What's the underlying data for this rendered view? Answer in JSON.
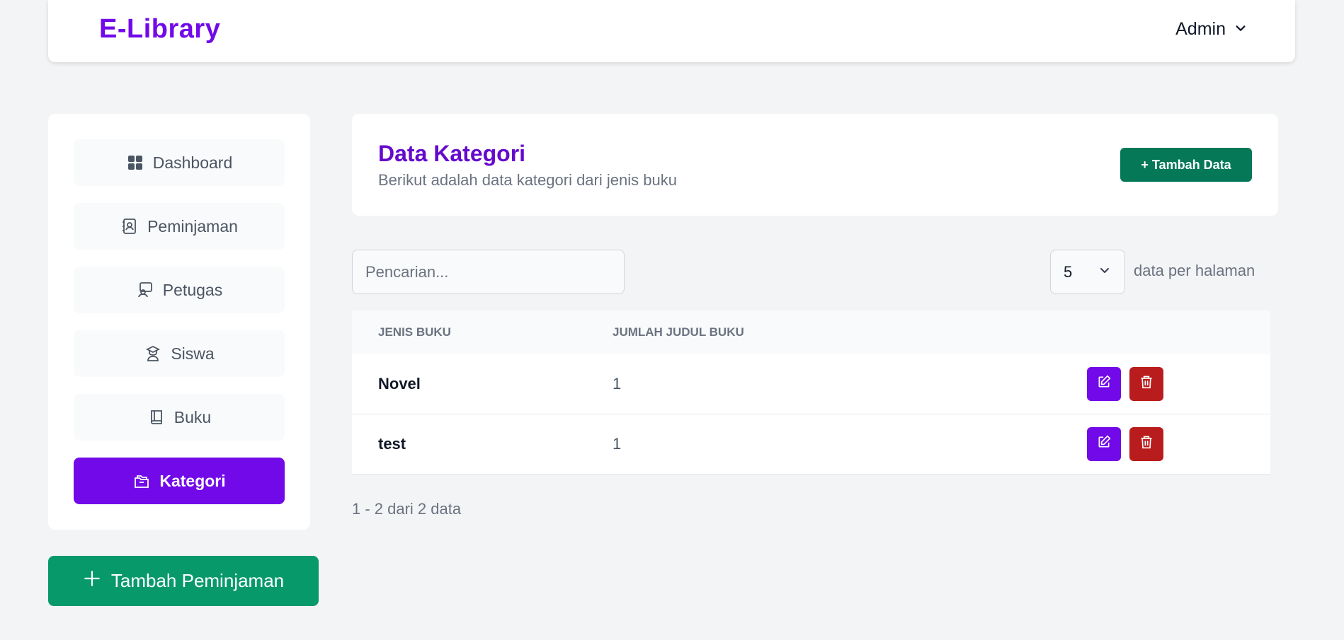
{
  "header": {
    "brand": "E-Library",
    "user_name": "Admin"
  },
  "sidebar": {
    "items": [
      {
        "label": "Dashboard",
        "icon": "dashboard-icon",
        "active": false
      },
      {
        "label": "Peminjaman",
        "icon": "contact-book-icon",
        "active": false
      },
      {
        "label": "Petugas",
        "icon": "staff-icon",
        "active": false
      },
      {
        "label": "Siswa",
        "icon": "student-icon",
        "active": false
      },
      {
        "label": "Buku",
        "icon": "book-icon",
        "active": false
      },
      {
        "label": "Kategori",
        "icon": "folders-icon",
        "active": true
      }
    ],
    "add_loan_label": "Tambah Peminjaman"
  },
  "main": {
    "title": "Data Kategori",
    "subtitle": "Berikut adalah data kategori dari jenis buku",
    "add_button_label": "+ Tambah Data",
    "search": {
      "placeholder": "Pencarian...",
      "value": ""
    },
    "per_page": {
      "value": "5",
      "label": "data per halaman"
    },
    "table": {
      "headers": [
        "Jenis Buku",
        "Jumlah Judul Buku"
      ],
      "rows": [
        {
          "jenis": "Novel",
          "jumlah": "1"
        },
        {
          "jenis": "test",
          "jumlah": "1"
        }
      ]
    },
    "pagination_info": "1 - 2 dari 2 data"
  },
  "colors": {
    "brand": "#7209e8",
    "title": "#6509cc",
    "active_nav": "#7209e8",
    "add_loan_button": "#07996a",
    "add_data_button": "#047857",
    "edit_button": "#7209e8",
    "delete_button": "#b91c1c"
  }
}
